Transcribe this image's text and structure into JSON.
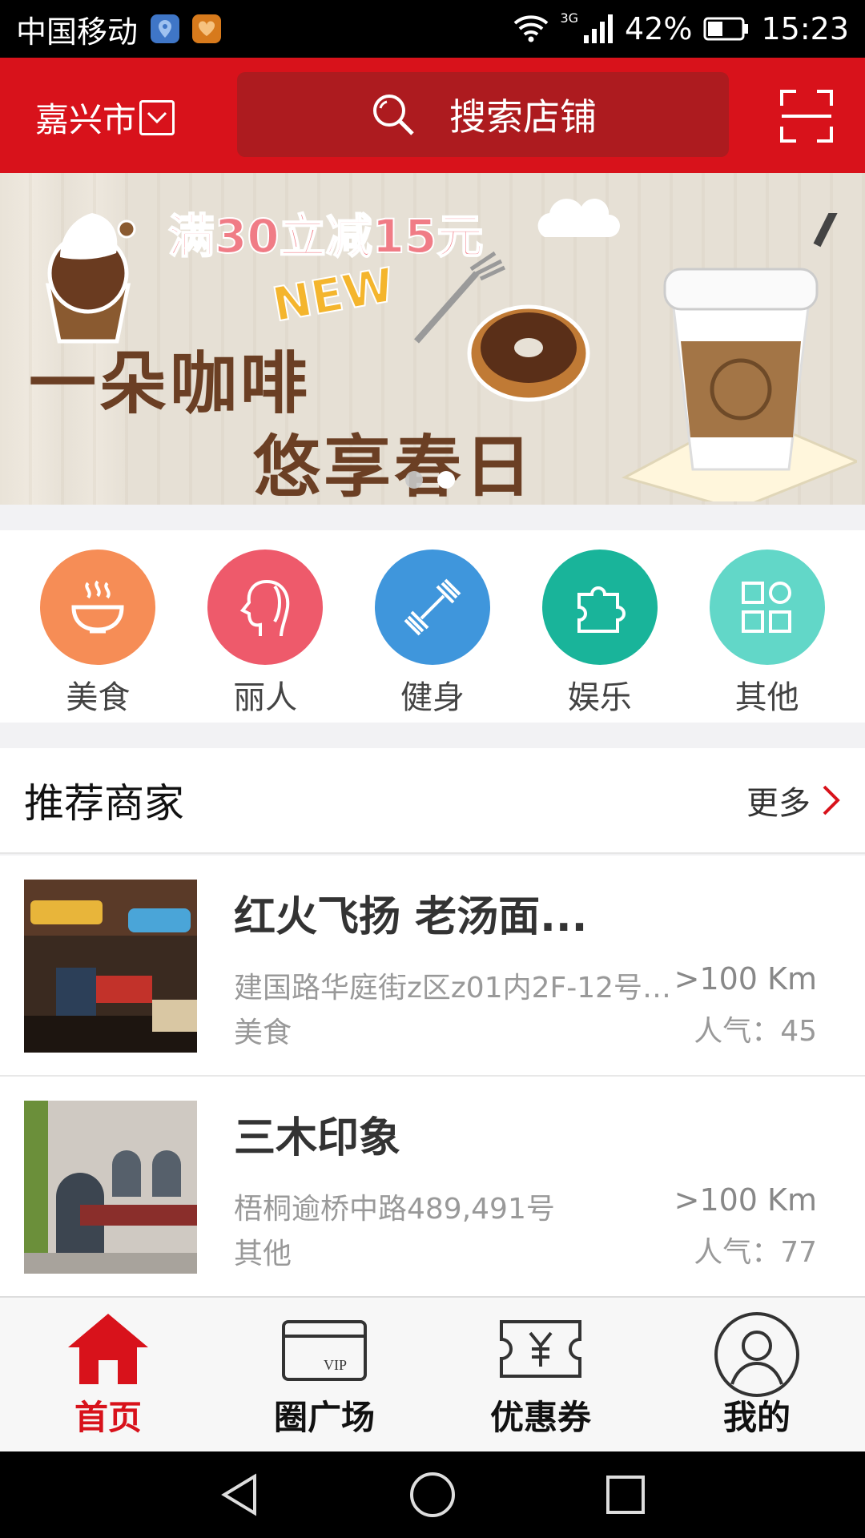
{
  "status_bar": {
    "carrier": "中国移动",
    "network": "3G",
    "battery": "42%",
    "time": "15:23"
  },
  "header": {
    "city": "嘉兴市",
    "search_placeholder": "搜索店铺"
  },
  "banner": {
    "promo": "满30立减15元",
    "new_tag": "NEW",
    "headline_line1": "一朵咖啡",
    "headline_line2": "悠享春日",
    "active_slide": 2,
    "slide_count": 2
  },
  "categories": [
    {
      "label": "美食",
      "icon": "bowl-icon",
      "color": "#f68d56"
    },
    {
      "label": "丽人",
      "icon": "lady-profile-icon",
      "color": "#ee5a6b"
    },
    {
      "label": "健身",
      "icon": "dumbbell-icon",
      "color": "#3f96dc"
    },
    {
      "label": "娱乐",
      "icon": "puzzle-icon",
      "color": "#19b49a"
    },
    {
      "label": "其他",
      "icon": "grid-icon",
      "color": "#62d7c8"
    }
  ],
  "recommended": {
    "title": "推荐商家",
    "more_label": "更多",
    "items": [
      {
        "name": "红火飞扬 老汤面...",
        "address": "建国路华庭街z区z01内2F-12号商...",
        "category": "美食",
        "distance": ">100 Km",
        "popularity": "人气：45"
      },
      {
        "name": "三木印象",
        "address": "梧桐逾桥中路489,491号",
        "category": "其他",
        "distance": ">100 Km",
        "popularity": "人气：77"
      }
    ]
  },
  "bottom_nav": [
    {
      "label": "首页",
      "icon": "home-icon",
      "active": true
    },
    {
      "label": "圈广场",
      "icon": "vip-card-icon",
      "active": false
    },
    {
      "label": "优惠券",
      "icon": "coupon-icon",
      "active": false
    },
    {
      "label": "我的",
      "icon": "user-icon",
      "active": false
    }
  ],
  "colors": {
    "brand": "#d8121b",
    "search_bg": "#ad1b1f"
  }
}
